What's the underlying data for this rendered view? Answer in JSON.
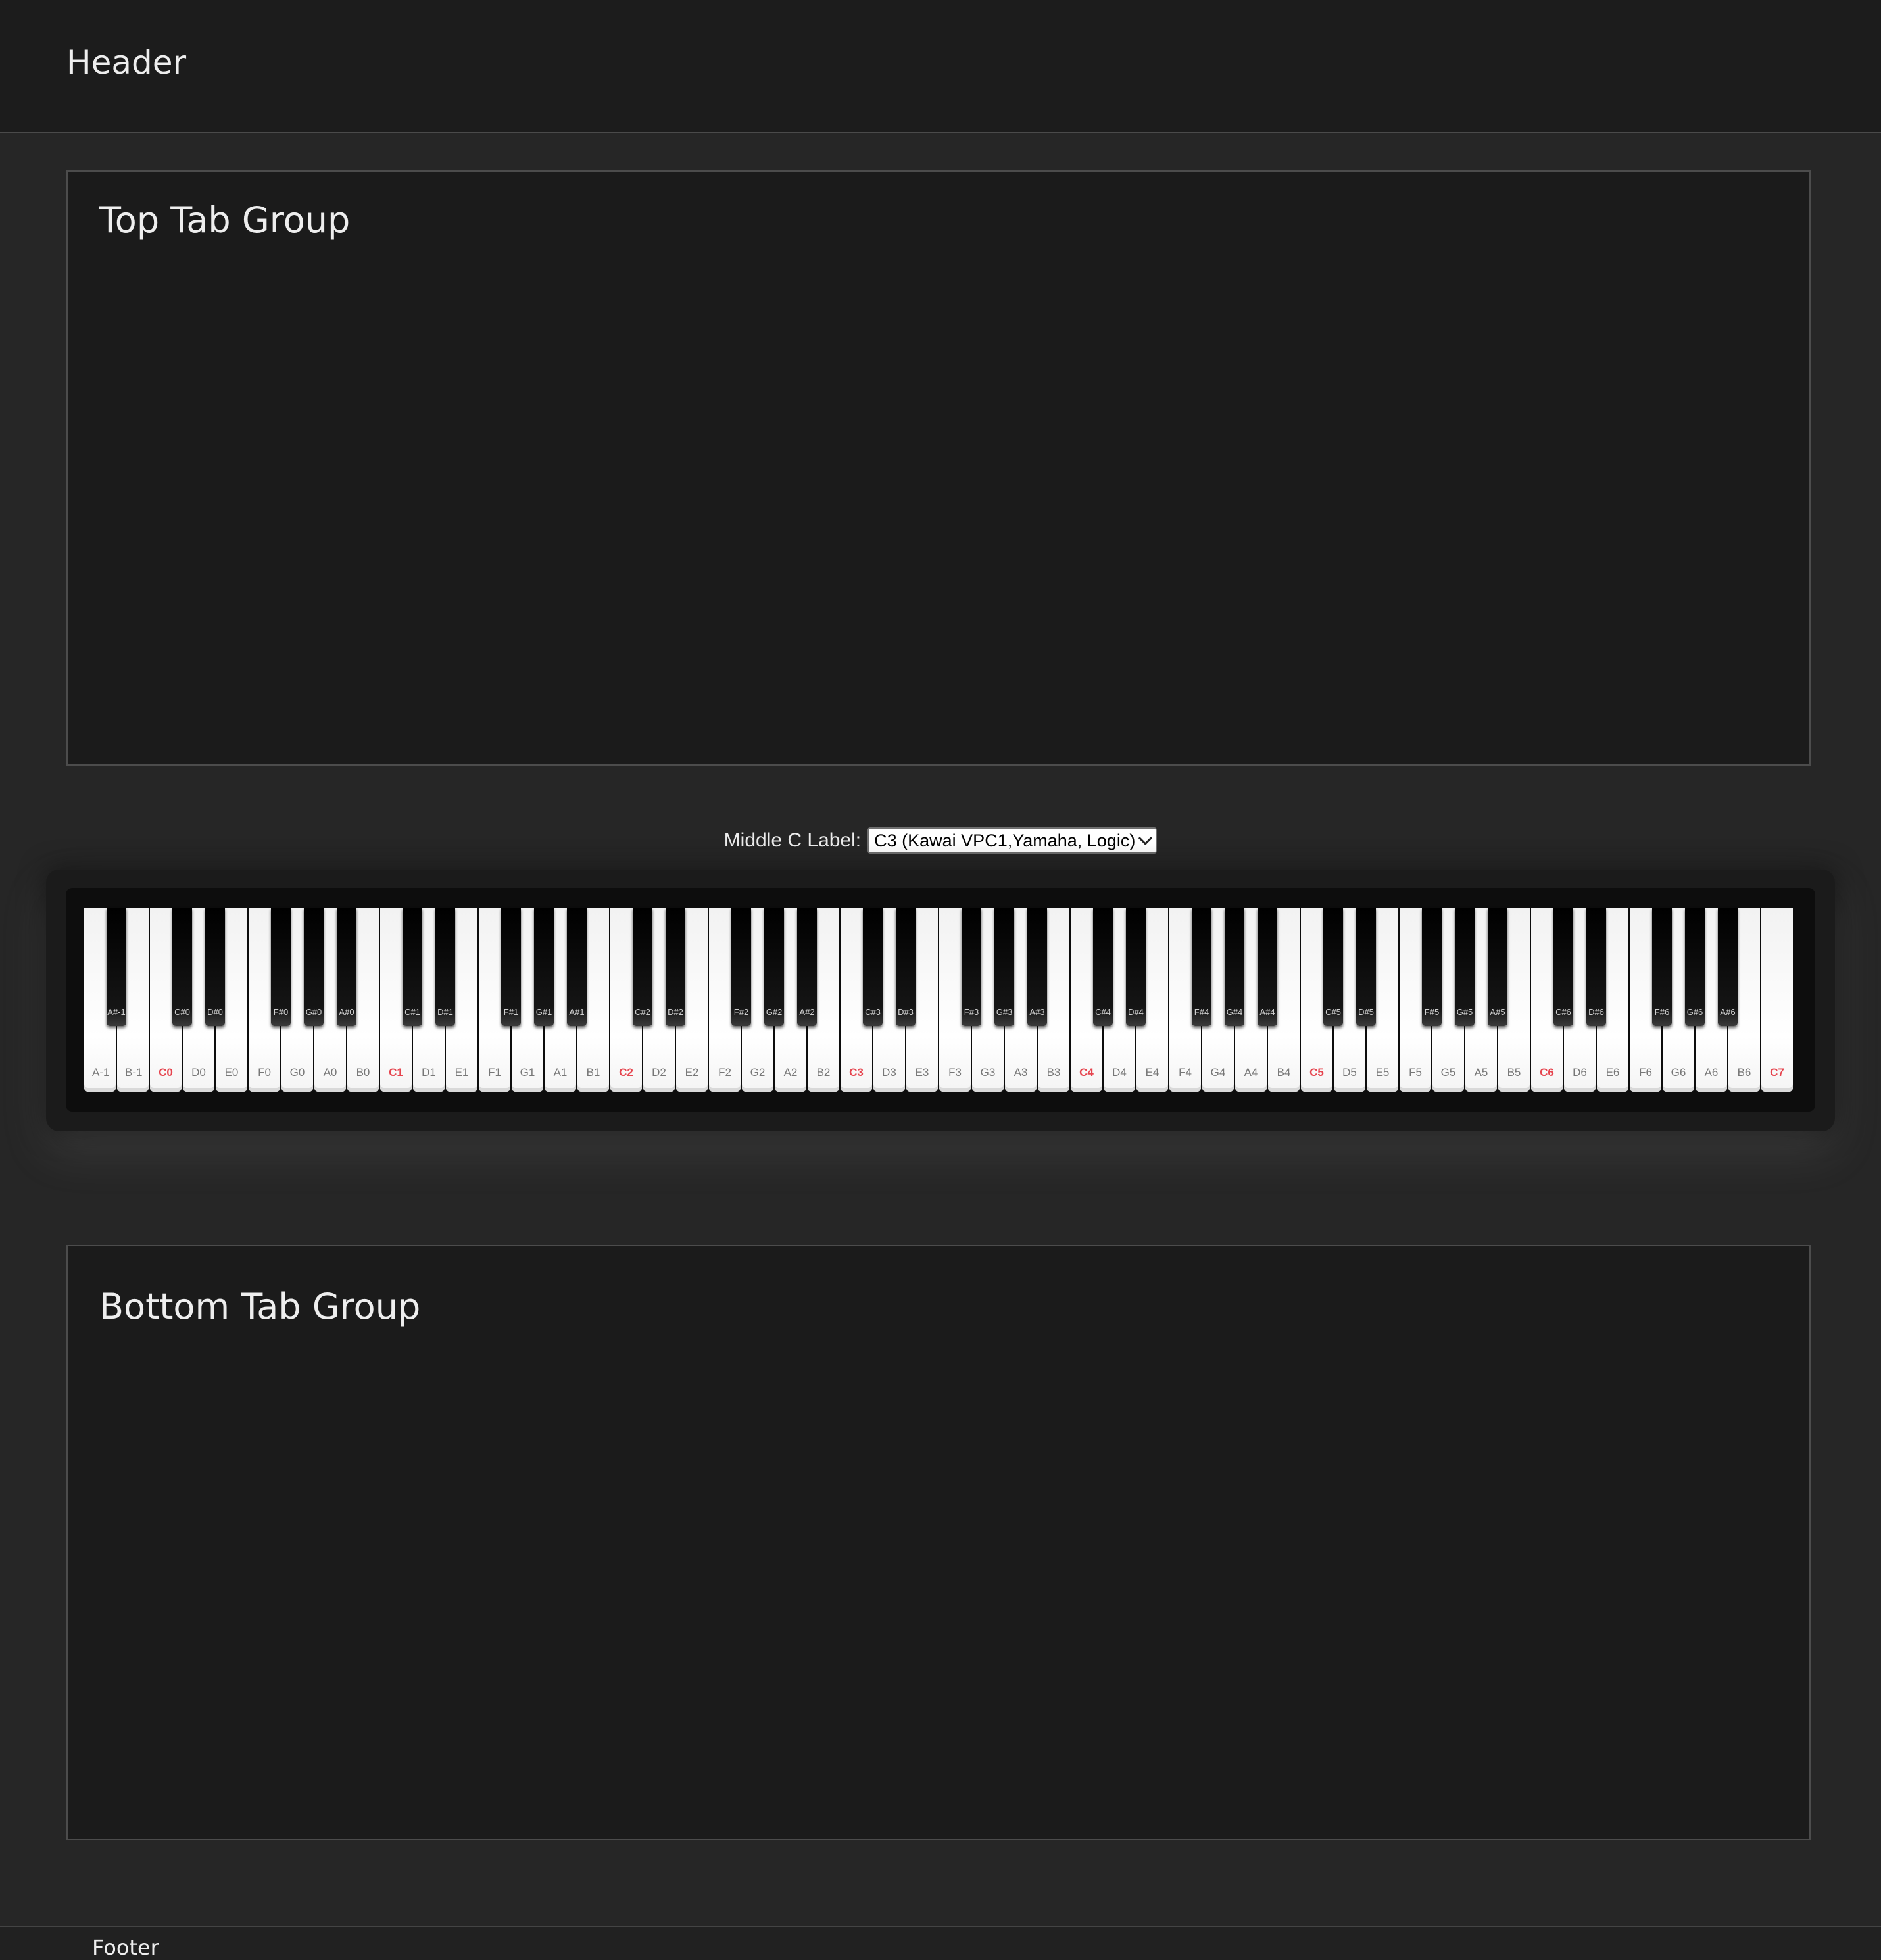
{
  "header": {
    "title": "Header"
  },
  "top_panel": {
    "title": "Top Tab Group"
  },
  "bottom_panel": {
    "title": "Bottom Tab Group"
  },
  "middle_c": {
    "label": "Middle C Label:",
    "selected": "C3 (Kawai VPC1,Yamaha, Logic)"
  },
  "piano": {
    "white_keys": [
      "A-1",
      "B-1",
      "C0",
      "D0",
      "E0",
      "F0",
      "G0",
      "A0",
      "B0",
      "C1",
      "D1",
      "E1",
      "F1",
      "G1",
      "A1",
      "B1",
      "C2",
      "D2",
      "E2",
      "F2",
      "G2",
      "A2",
      "B2",
      "C3",
      "D3",
      "E3",
      "F3",
      "G3",
      "A3",
      "B3",
      "C4",
      "D4",
      "E4",
      "F4",
      "G4",
      "A4",
      "B4",
      "C5",
      "D5",
      "E5",
      "F5",
      "G5",
      "A5",
      "B5",
      "C6",
      "D6",
      "E6",
      "F6",
      "G6",
      "A6",
      "B6",
      "C7"
    ],
    "black_keys": [
      "A#-1",
      "C#0",
      "D#0",
      "F#0",
      "G#0",
      "A#0",
      "C#1",
      "D#1",
      "F#1",
      "G#1",
      "A#1",
      "C#2",
      "D#2",
      "F#2",
      "G#2",
      "A#2",
      "C#3",
      "D#3",
      "F#3",
      "G#3",
      "A#3",
      "C#4",
      "D#4",
      "F#4",
      "G#4",
      "A#4",
      "C#5",
      "D#5",
      "F#5",
      "G#5",
      "A#5",
      "C#6",
      "D#6",
      "F#6",
      "G#6",
      "A#6"
    ],
    "c_label_color": "#e6454f"
  },
  "footer": {
    "text": "Footer"
  }
}
